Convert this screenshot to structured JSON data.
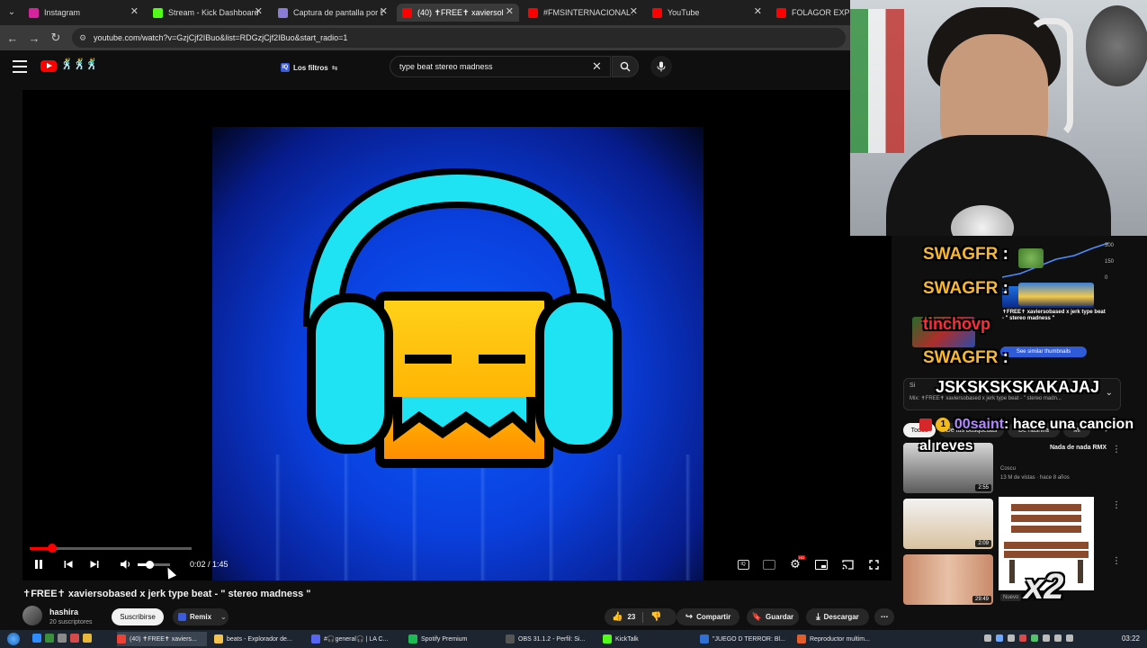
{
  "browser": {
    "tabs": [
      {
        "label": "Instagram",
        "color": "#d6249f"
      },
      {
        "label": "Stream - Kick Dashboard",
        "color": "#53fc18"
      },
      {
        "label": "Captura de pantalla por L",
        "color": "#8a7bd8"
      },
      {
        "label": "(40) ✝FREE✝ xaviersol",
        "color": "#ff0000"
      },
      {
        "label": "#FMSINTERNACIONAL 20",
        "color": "#ff0000"
      },
      {
        "label": "YouTube",
        "color": "#ff0000"
      },
      {
        "label": "FOLAGOR EXPLOTA",
        "color": "#ff0000"
      }
    ],
    "url": "youtube.com/watch?v=GzjCjf2IBuo&list=RDGzjCjf2IBuo&start_radio=1"
  },
  "youtube": {
    "filters_label": "Los filtros",
    "search_value": "type beat stereo madness",
    "video": {
      "time": "0:02 / 1:45",
      "progress": 0.14,
      "volume": 0.35,
      "title": "✝FREE✝ xaviersobased x jerk type beat - \" stereo madness \""
    },
    "channel": {
      "name": "hashira",
      "subs": "20 suscriptores"
    },
    "buttons": {
      "subscribe": "Suscribirse",
      "remix": "Remix",
      "likes": "23",
      "share": "Compartir",
      "save": "Guardar",
      "download": "Descargar"
    }
  },
  "sidebar": {
    "mix_title": "Si",
    "mix_sub": "Mix: ✝FREE✝ xaviersobased x jerk type beat - \" stereo madn...",
    "chips": [
      "Todos",
      "De tus búsquedas",
      "De hashira",
      "Mi"
    ],
    "thumb_badge": "See similar thumbnails",
    "thumb_caption": "✝FREE✝ xaviersobased x jerk type beat - \" stereo madness \"",
    "graph_ticks": [
      "300",
      "150",
      "0"
    ],
    "recs": [
      {
        "title": "Nada de nada RMX",
        "channel": "Coscu",
        "meta": "13 M de vistas · hace 8 años",
        "dur": "2:55"
      },
      {
        "title": "",
        "channel": "",
        "meta": "",
        "dur": "2:09"
      },
      {
        "title": "",
        "channel": "",
        "meta": "",
        "dur": "29:49"
      }
    ],
    "rec3_new": "Nuevo"
  },
  "chat": {
    "lines": [
      {
        "user": "SWAGFR",
        "msg": ":"
      },
      {
        "user": "SWAGFR",
        "msg": ":"
      },
      {
        "user": "tinchovp",
        "msg": ""
      },
      {
        "user": "SWAGFR",
        "msg": ":"
      },
      {
        "user": "JSKSKSKSKAKAJAJ",
        "msg": ""
      },
      {
        "user": "00saint",
        "msg": ": hace una cancion al reves",
        "badge": "1"
      }
    ],
    "multiplier": "x2"
  },
  "taskbar": {
    "items": [
      {
        "label": "(40) ✝FREE✝ xaviers...",
        "color": "#ea4335"
      },
      {
        "label": "beats - Explorador de...",
        "color": "#f2c14e"
      },
      {
        "label": "#🎧general🎧 | LA C...",
        "color": "#5865f2"
      },
      {
        "label": "Spotify Premium",
        "color": "#1db954"
      },
      {
        "label": "OBS 31.1.2 - Perfil: Si...",
        "color": "#444444"
      },
      {
        "label": "KickTalk",
        "color": "#53fc18"
      },
      {
        "label": "\"JUEGO D TERROR: Bl...",
        "color": "#2f6fd6"
      },
      {
        "label": "Reproductor multim...",
        "color": "#e35d2a"
      }
    ],
    "clock": "03:22"
  }
}
